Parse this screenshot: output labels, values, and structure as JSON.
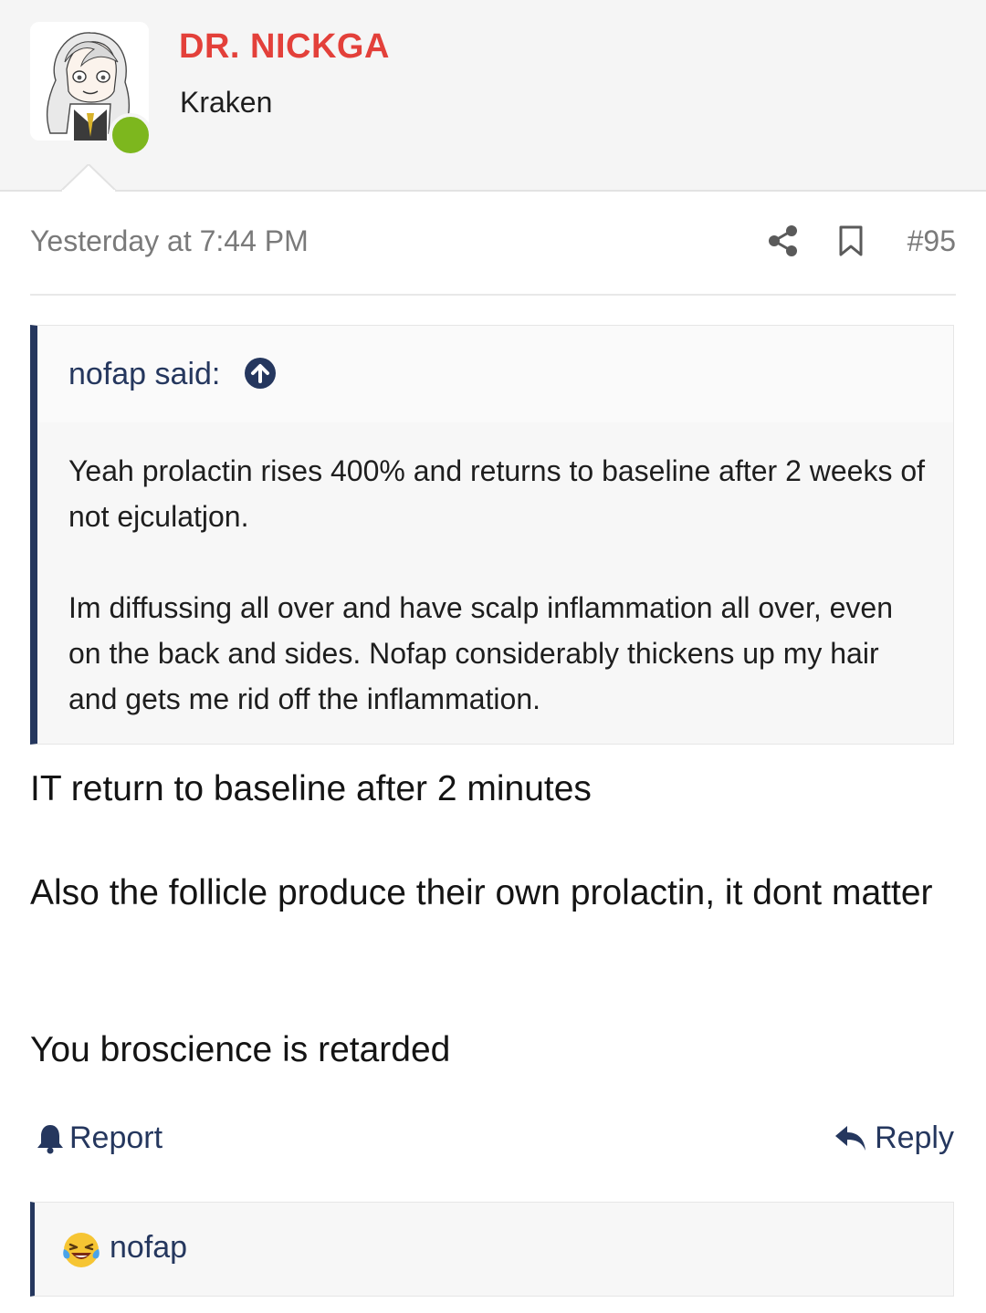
{
  "author": {
    "name": "DR. NICKGA",
    "title": "Kraken",
    "avatar_icon": "anime-avatar",
    "status": "online",
    "status_color": "#7db71e",
    "name_color": "#e3403a"
  },
  "post": {
    "timestamp": "Yesterday at 7:44 PM",
    "number": "#95",
    "icons": [
      "share-icon",
      "bookmark-icon"
    ]
  },
  "quote": {
    "author": "nofap said:",
    "paragraphs": [
      "Yeah prolactin rises 400% and returns to baseline after 2 weeks of not ejculatjon.",
      "Im diffussing all over and have scalp inflammation all over, even on the back and sides. Nofap considerably thickens up my hair and gets me rid off the inflammation."
    ],
    "accent_color": "#25375e"
  },
  "body": {
    "paragraphs": [
      "IT return to baseline after 2 minutes",
      "Also the follicle produce their own prolactin, it dont matter",
      "You broscience is retarded"
    ]
  },
  "actions": {
    "report_label": "Report",
    "reply_label": "Reply"
  },
  "reactions": {
    "emoji": "laughing-crying-emoji",
    "user": "nofap"
  }
}
